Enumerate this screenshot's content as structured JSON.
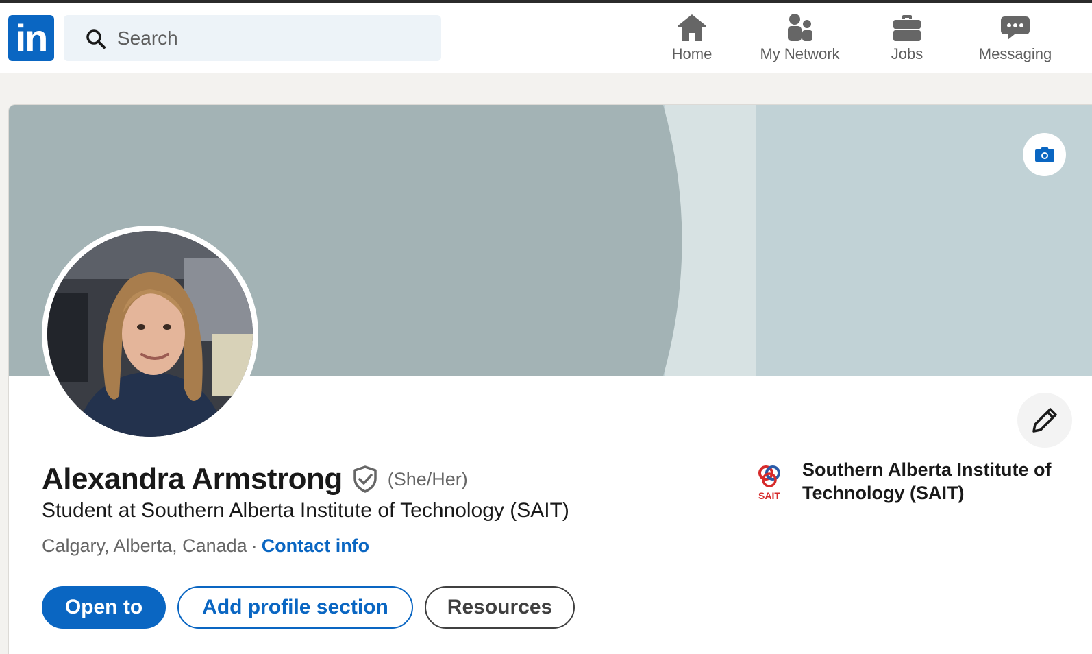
{
  "nav": {
    "logo_text": "in",
    "search_placeholder": "Search",
    "items": [
      {
        "label": "Home",
        "icon": "home-icon"
      },
      {
        "label": "My Network",
        "icon": "people-icon"
      },
      {
        "label": "Jobs",
        "icon": "briefcase-icon"
      },
      {
        "label": "Messaging",
        "icon": "message-icon"
      }
    ]
  },
  "colors": {
    "brand_blue": "#0a66c2",
    "banner_light": "#c1d2d6",
    "banner_dark": "#a3b3b5"
  },
  "profile": {
    "name": "Alexandra Armstrong",
    "pronouns": "(She/Her)",
    "headline": "Student at Southern Alberta Institute of Technology (SAIT)",
    "location": "Calgary, Alberta, Canada",
    "separator": "·",
    "contact_link": "Contact info",
    "school": {
      "name": "Southern Alberta Institute of Technology (SAIT)",
      "logo_text": "SAIT"
    },
    "buttons": {
      "open_to": "Open to",
      "add_section": "Add profile section",
      "resources": "Resources"
    }
  }
}
